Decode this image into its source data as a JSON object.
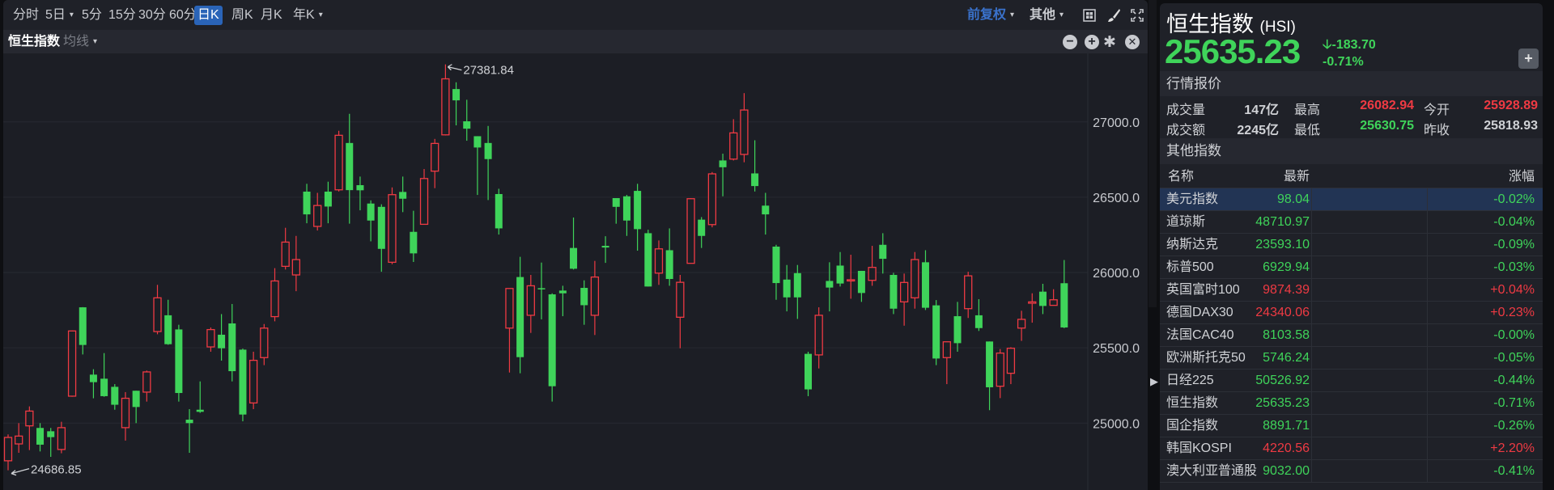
{
  "toolbar": {
    "periods": [
      "分时",
      "5日",
      "5分",
      "15分",
      "30分",
      "60分",
      "日K",
      "周K",
      "月K",
      "年K"
    ],
    "active": "日K",
    "adjust": "前复权",
    "other": "其他"
  },
  "subbar": {
    "name": "恒生指数",
    "ma": "均线"
  },
  "quote": {
    "title": "恒生指数",
    "code": "(HSI)",
    "price": "25635.23",
    "change": "-183.70",
    "change_pct": "-0.71%",
    "section_quote": "行情报价",
    "volume_label": "成交量",
    "volume": "147亿",
    "amount_label": "成交额",
    "amount": "2245亿",
    "high_label": "最高",
    "high": "26082.94",
    "low_label": "最低",
    "low": "25630.75",
    "open_label": "今开",
    "open": "25928.89",
    "prev_label": "昨收",
    "prev": "25818.93",
    "add_label": "+"
  },
  "others": {
    "section": "其他指数",
    "headers": [
      "名称",
      "最新",
      "涨幅"
    ],
    "rows": [
      {
        "name": "美元指数",
        "last": "98.04",
        "pct": "-0.02%",
        "dir": "down"
      },
      {
        "name": "道琼斯",
        "last": "48710.97",
        "pct": "-0.04%",
        "dir": "down"
      },
      {
        "name": "纳斯达克",
        "last": "23593.10",
        "pct": "-0.09%",
        "dir": "down"
      },
      {
        "name": "标普500",
        "last": "6929.94",
        "pct": "-0.03%",
        "dir": "down"
      },
      {
        "name": "英国富时100",
        "last": "9874.39",
        "pct": "+0.04%",
        "dir": "up"
      },
      {
        "name": "德国DAX30",
        "last": "24340.06",
        "pct": "+0.23%",
        "dir": "up"
      },
      {
        "name": "法国CAC40",
        "last": "8103.58",
        "pct": "-0.00%",
        "dir": "down"
      },
      {
        "name": "欧洲斯托克50",
        "last": "5746.24",
        "pct": "-0.05%",
        "dir": "down"
      },
      {
        "name": "日经225",
        "last": "50526.92",
        "pct": "-0.44%",
        "dir": "down"
      },
      {
        "name": "恒生指数",
        "last": "25635.23",
        "pct": "-0.71%",
        "dir": "down"
      },
      {
        "name": "国企指数",
        "last": "8891.71",
        "pct": "-0.26%",
        "dir": "down"
      },
      {
        "name": "韩国KOSPI",
        "last": "4220.56",
        "pct": "+2.20%",
        "dir": "up"
      },
      {
        "name": "澳大利亚普通股",
        "last": "9032.00",
        "pct": "-0.41%",
        "dir": "down"
      }
    ]
  },
  "colors": {
    "up": "#ef3a43",
    "down": "#3fd45a",
    "accent": "#2a64b8",
    "bg": "#1c1e25"
  },
  "chart_data": {
    "type": "candlestick",
    "title": "恒生指数 日K",
    "ylim": [
      24556,
      27455
    ],
    "yticks": [
      25000,
      25500,
      26000,
      26500,
      27000
    ],
    "ytick_labels": [
      "25000.0",
      "25500.0",
      "26000.0",
      "26500.0",
      "27000.0"
    ],
    "grid": true,
    "max_label": "27381.84",
    "max_index": 41,
    "min_label": "24686.85",
    "min_index": 0,
    "ohlc": [
      [
        24750,
        24925,
        24686.85,
        24905
      ],
      [
        24862,
        25000,
        24803,
        24914
      ],
      [
        24982,
        25111,
        24821,
        25080
      ],
      [
        24968,
        25000,
        24812,
        24857
      ],
      [
        24946,
        24968,
        24776,
        24907
      ],
      [
        24825,
        25009,
        24800,
        24970
      ],
      [
        25179,
        25615,
        25175,
        25612
      ],
      [
        25769,
        25770,
        25456,
        25519
      ],
      [
        25322,
        25358,
        25165,
        25272
      ],
      [
        25295,
        25465,
        25175,
        25179
      ],
      [
        25241,
        25259,
        25089,
        25122
      ],
      [
        24970,
        25206,
        24884,
        25165
      ],
      [
        25215,
        25215,
        25000,
        25107
      ],
      [
        25206,
        25349,
        25143,
        25340
      ],
      [
        25608,
        25918,
        25590,
        25832
      ],
      [
        25716,
        25819,
        25520,
        25524
      ],
      [
        25622,
        25653,
        25143,
        25200
      ],
      [
        25023,
        25093,
        24803,
        25000
      ],
      [
        25089,
        25277,
        25068,
        25075
      ],
      [
        25506,
        25635,
        25474,
        25621
      ],
      [
        25587,
        25724,
        25415,
        25497
      ],
      [
        25662,
        25791,
        25277,
        25345
      ],
      [
        25488,
        25495,
        25012,
        25057
      ],
      [
        25134,
        25474,
        25093,
        25417
      ],
      [
        25435,
        25658,
        25385,
        25631
      ],
      [
        25707,
        26029,
        25676,
        25944
      ],
      [
        26041,
        26297,
        26020,
        26202
      ],
      [
        25984,
        26243,
        25876,
        26086
      ],
      [
        26537,
        26589,
        26327,
        26386
      ],
      [
        26306,
        26529,
        26279,
        26445
      ],
      [
        26537,
        26603,
        26327,
        26438
      ],
      [
        26549,
        26941,
        26538,
        26911
      ],
      [
        26860,
        27054,
        26324,
        26547
      ],
      [
        26580,
        26637,
        26413,
        26546
      ],
      [
        26458,
        26479,
        26207,
        26345
      ],
      [
        26436,
        26453,
        26005,
        26157
      ],
      [
        26068,
        26565,
        26055,
        26517
      ],
      [
        26535,
        26637,
        26401,
        26490
      ],
      [
        26270,
        26410,
        26070,
        26127
      ],
      [
        26320,
        26687,
        26318,
        26624
      ],
      [
        26673,
        26887,
        26560,
        26857
      ],
      [
        26914,
        27381.84,
        26910,
        27286
      ],
      [
        27218,
        27263,
        26977,
        27143
      ],
      [
        27004,
        27147,
        26875,
        26955
      ],
      [
        26905,
        26905,
        26515,
        26830
      ],
      [
        26860,
        26973,
        26481,
        26753
      ],
      [
        26521,
        26556,
        26252,
        26293
      ],
      [
        25631,
        25895,
        25336,
        25894
      ],
      [
        25970,
        26104,
        25331,
        25438
      ],
      [
        25716,
        25984,
        25599,
        25912
      ],
      [
        25896,
        26066,
        25689,
        25890
      ],
      [
        25855,
        25862,
        25143,
        25245
      ],
      [
        25880,
        25912,
        25710,
        25862
      ],
      [
        26163,
        26365,
        26020,
        26025
      ],
      [
        25898,
        25948,
        25653,
        25783
      ],
      [
        25716,
        26077,
        25585,
        25970
      ],
      [
        26177,
        26241,
        26064,
        26166
      ],
      [
        26494,
        26494,
        26324,
        26436
      ],
      [
        26506,
        26515,
        26243,
        26345
      ],
      [
        26542,
        26589,
        26145,
        26288
      ],
      [
        26261,
        26284,
        25907,
        25907
      ],
      [
        25996,
        26213,
        25918,
        26157
      ],
      [
        26148,
        26293,
        25912,
        25957
      ],
      [
        25703,
        25984,
        25497,
        25935
      ],
      [
        26061,
        26494,
        26061,
        26490
      ],
      [
        26351,
        26368,
        26163,
        26243
      ],
      [
        26318,
        26667,
        26300,
        26655
      ],
      [
        26744,
        26789,
        26506,
        26699
      ],
      [
        26753,
        27018,
        26744,
        26927
      ],
      [
        26784,
        27191,
        26732,
        27079
      ],
      [
        26658,
        26878,
        26538,
        26574
      ],
      [
        26444,
        26529,
        26252,
        26386
      ],
      [
        26172,
        26184,
        25819,
        25930
      ],
      [
        25953,
        26050,
        25742,
        25835
      ],
      [
        25996,
        26050,
        25692,
        25835
      ],
      [
        25460,
        25474,
        25179,
        25224
      ],
      [
        25453,
        25769,
        25363,
        25716
      ],
      [
        25944,
        26068,
        25742,
        25900
      ],
      [
        26046,
        26136,
        25907,
        25927
      ],
      [
        25945,
        26118,
        25826,
        25952
      ],
      [
        26011,
        26011,
        25805,
        25864
      ],
      [
        25948,
        26177,
        25912,
        26034
      ],
      [
        26184,
        26261,
        25993,
        26091
      ],
      [
        25984,
        25998,
        25724,
        25760
      ],
      [
        25805,
        25993,
        25647,
        25934
      ],
      [
        25832,
        26136,
        25760,
        26086
      ],
      [
        26068,
        26148,
        25751,
        25766
      ],
      [
        25782,
        25817,
        25385,
        25429
      ],
      [
        25435,
        25540,
        25259,
        25540
      ],
      [
        25710,
        25805,
        25474,
        25531
      ],
      [
        25760,
        26005,
        25698,
        25978
      ],
      [
        25716,
        25823,
        25612,
        25631
      ],
      [
        25542,
        25542,
        25086,
        25238
      ],
      [
        25245,
        25492,
        25166,
        25465
      ],
      [
        25331,
        25504,
        25259,
        25497
      ],
      [
        25631,
        25746,
        25546,
        25689
      ],
      [
        25796,
        25862,
        25667,
        25805
      ],
      [
        25873,
        25925,
        25724,
        25778
      ],
      [
        25782,
        25889,
        25782,
        25819
      ],
      [
        25928.89,
        26082.94,
        25630.75,
        25635.23
      ]
    ]
  }
}
